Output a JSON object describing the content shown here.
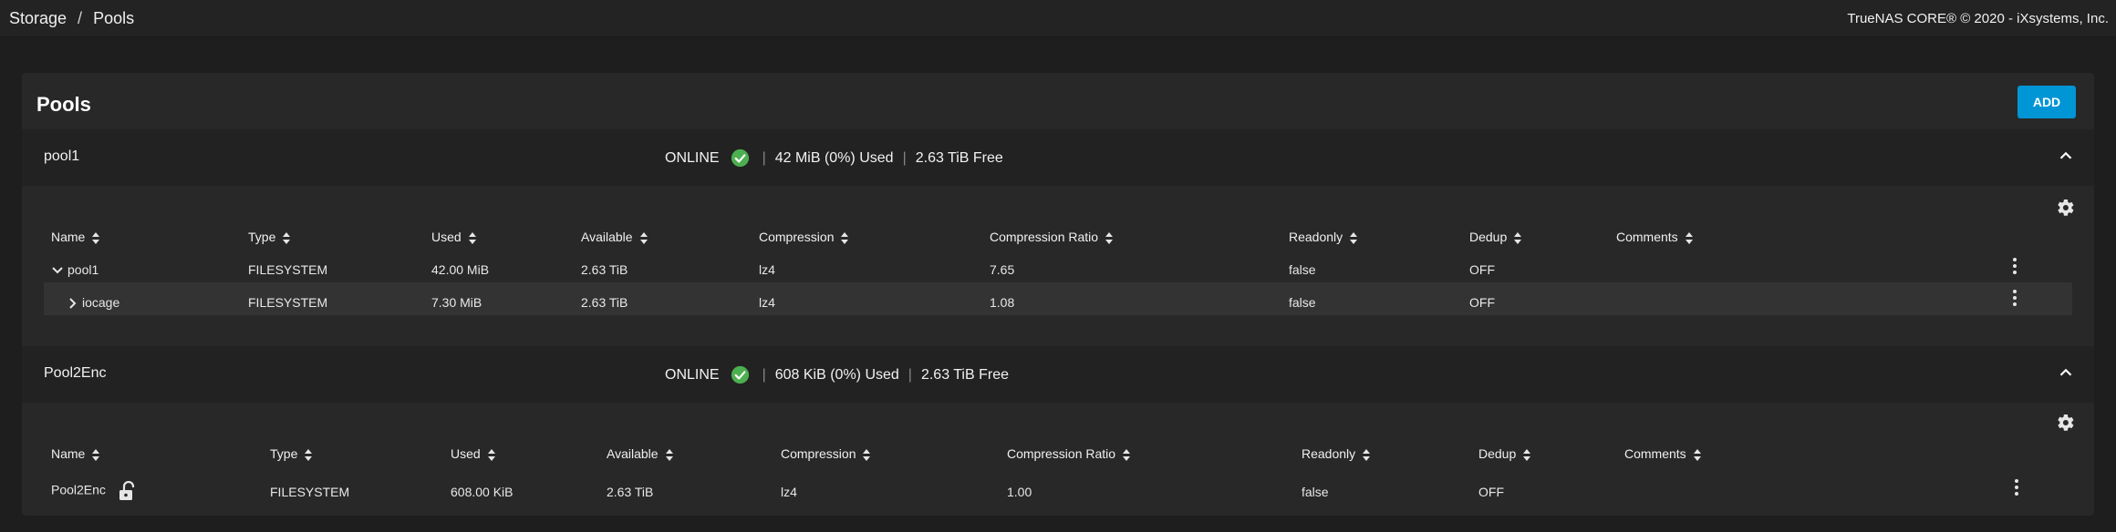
{
  "breadcrumb": [
    "Storage",
    "Pools"
  ],
  "copyright": "TrueNAS CORE® © 2020 - iXsystems, Inc.",
  "page": {
    "title": "Pools",
    "add_label": "ADD"
  },
  "columns": [
    "Name",
    "Type",
    "Used",
    "Available",
    "Compression",
    "Compression Ratio",
    "Readonly",
    "Dedup",
    "Comments"
  ],
  "pools": [
    {
      "name": "pool1",
      "status": "ONLINE",
      "used": "42 MiB (0%) Used",
      "free": "2.63 TiB Free",
      "rows": [
        {
          "name": "pool1",
          "type": "FILESYSTEM",
          "used": "42.00 MiB",
          "available": "2.63 TiB",
          "compression": "lz4",
          "ratio": "7.65",
          "readonly": "false",
          "dedup": "OFF",
          "comments": ""
        },
        {
          "name": "iocage",
          "type": "FILESYSTEM",
          "used": "7.30 MiB",
          "available": "2.63 TiB",
          "compression": "lz4",
          "ratio": "1.08",
          "readonly": "false",
          "dedup": "OFF",
          "comments": ""
        }
      ]
    },
    {
      "name": "Pool2Enc",
      "status": "ONLINE",
      "used": "608 KiB (0%) Used",
      "free": "2.63 TiB Free",
      "rows": [
        {
          "name": "Pool2Enc",
          "type": "FILESYSTEM",
          "used": "608.00 KiB",
          "available": "2.63 TiB",
          "compression": "lz4",
          "ratio": "1.00",
          "readonly": "false",
          "dedup": "OFF",
          "comments": ""
        }
      ]
    }
  ],
  "colors": {
    "accent": "#0095d5",
    "online": "#4caf50"
  },
  "icons": [
    "check-circle-icon",
    "chevron-up-icon",
    "gear-icon",
    "sort-icon",
    "more-vert-icon",
    "chevron-down-icon",
    "chevron-right-icon",
    "lock-open-icon"
  ]
}
